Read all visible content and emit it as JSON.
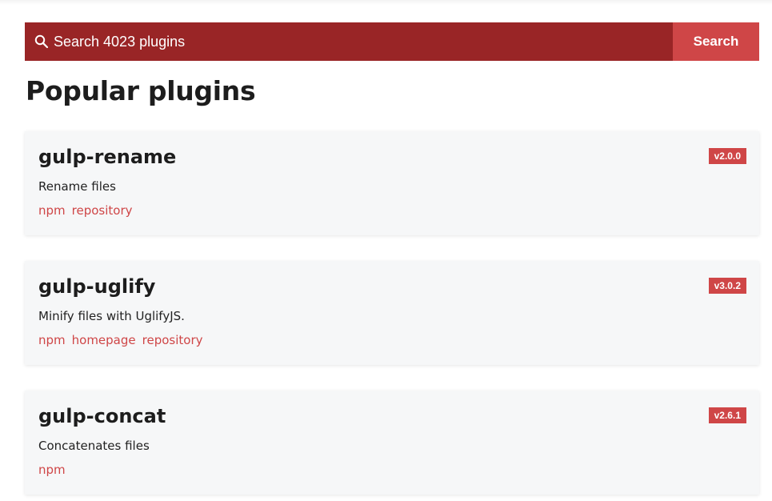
{
  "search": {
    "placeholder": "Search 4023 plugins",
    "button_label": "Search"
  },
  "page_title": "Popular plugins",
  "plugins": [
    {
      "name": "gulp-rename",
      "version": "v2.0.0",
      "description": "Rename files",
      "links": [
        "npm",
        "repository"
      ]
    },
    {
      "name": "gulp-uglify",
      "version": "v3.0.2",
      "description": "Minify files with UglifyJS.",
      "links": [
        "npm",
        "homepage",
        "repository"
      ]
    },
    {
      "name": "gulp-concat",
      "version": "v2.6.1",
      "description": "Concatenates files",
      "links": [
        "npm"
      ]
    }
  ],
  "colors": {
    "search_bg": "#992526",
    "accent": "#cf4647",
    "card_bg": "#f6f7f8"
  },
  "icons": {
    "search": "search-icon"
  }
}
